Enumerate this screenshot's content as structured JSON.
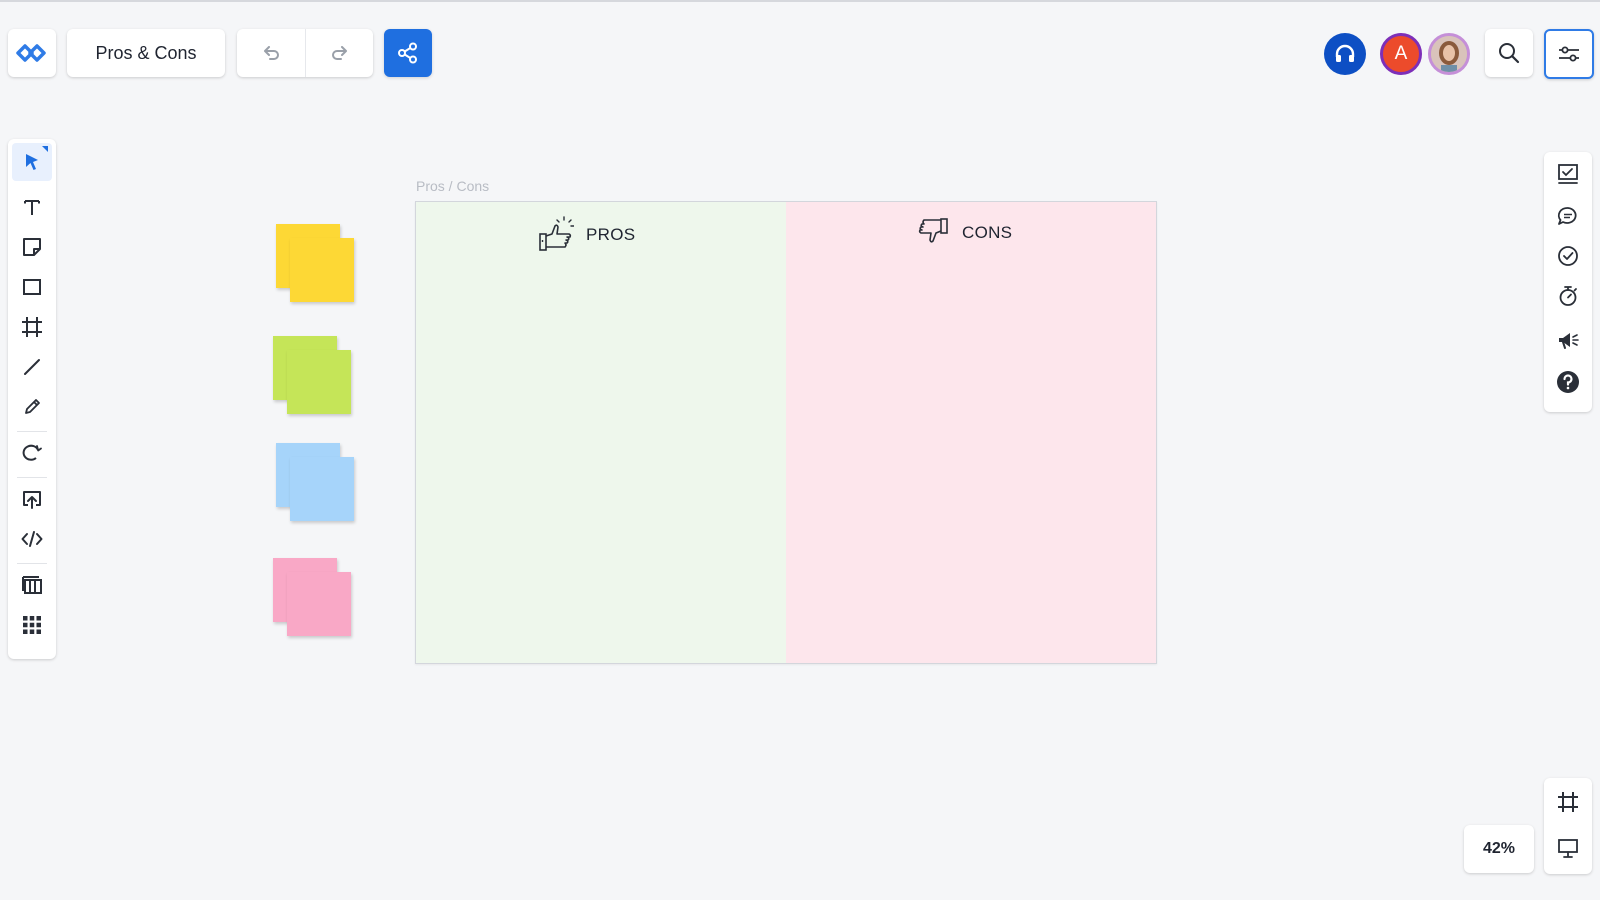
{
  "header": {
    "board_title": "Pros & Cons",
    "logo_icon": "whiteboard-logo-icon",
    "undo_icon": "undo-icon",
    "redo_icon": "redo-icon",
    "share_icon": "share-icon"
  },
  "collaborators": {
    "audio_icon": "headset-icon",
    "user_initial": "A",
    "photo_alt": "user-photo"
  },
  "toolbar_left": {
    "tools": [
      "select",
      "text",
      "sticky-note",
      "rectangle",
      "frame",
      "line",
      "pen",
      "lasso",
      "upload",
      "embed",
      "templates",
      "apps"
    ]
  },
  "toolbar_right": {
    "tools": [
      "activity",
      "comments",
      "tasks",
      "timer",
      "announcements",
      "help"
    ]
  },
  "canvas": {
    "frame_label": "Pros / Cons",
    "pros_label": "PROS",
    "cons_label": "CONS",
    "sticky_colors": [
      "#fdd835",
      "#c5e558",
      "#a6d4fa",
      "#f9a8c6"
    ]
  },
  "zoom": {
    "level": "42%"
  },
  "colors": {
    "accent": "#1f6fe0",
    "pros_bg": "#eef7ec",
    "cons_bg": "#fde6ec",
    "avatar_bg": "#ec4b2b"
  }
}
